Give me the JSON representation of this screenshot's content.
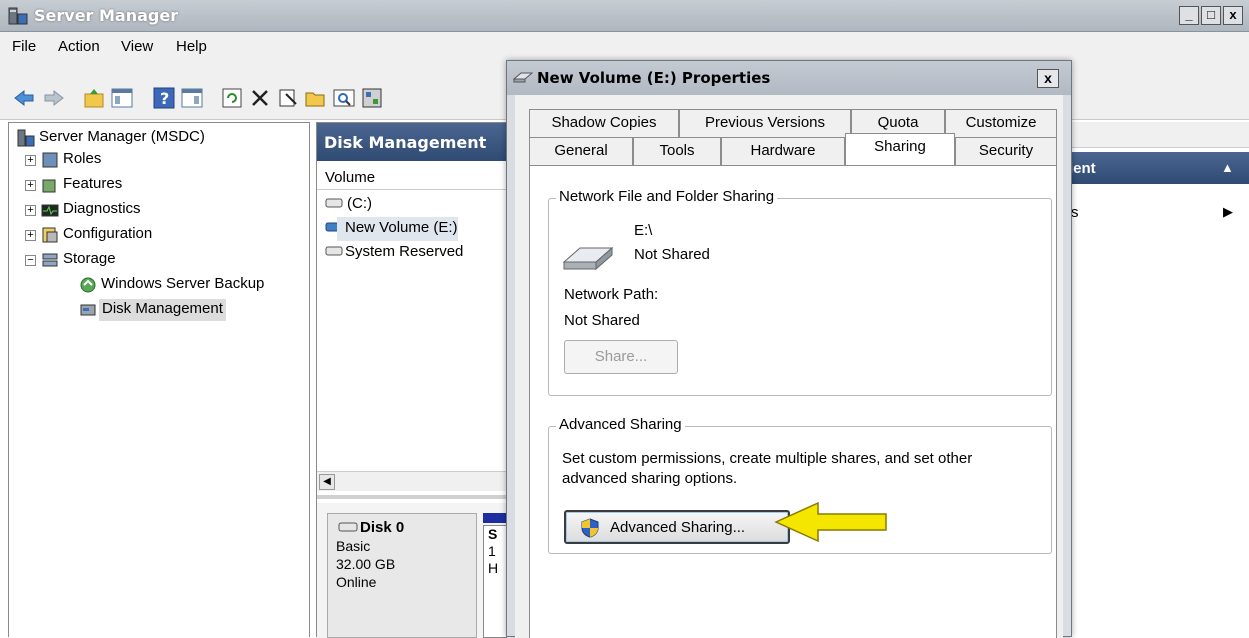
{
  "main_window": {
    "title": "Server Manager",
    "caption_buttons": {
      "minimize": "_",
      "maximize": "□",
      "close": "x"
    },
    "menu": [
      "File",
      "Action",
      "View",
      "Help"
    ]
  },
  "tree": {
    "root": "Server Manager (MSDC)",
    "items": [
      {
        "label": "Roles",
        "expander": "+"
      },
      {
        "label": "Features",
        "expander": "+"
      },
      {
        "label": "Diagnostics",
        "expander": "+"
      },
      {
        "label": "Configuration",
        "expander": "+"
      },
      {
        "label": "Storage",
        "expander": "−"
      }
    ],
    "storage_children": [
      "Windows Server Backup",
      "Disk Management"
    ]
  },
  "center": {
    "header": "Disk Management",
    "volume_column": "Volume",
    "volumes": [
      "(C:)",
      "New Volume (E:)",
      "System Reserved"
    ],
    "disk": {
      "name": "Disk 0",
      "type": "Basic",
      "size": "32.00 GB",
      "status": "Online"
    },
    "partition_col_letters": [
      "S",
      "1",
      "H"
    ]
  },
  "right_pane": {
    "header_fragment": "ient",
    "row_fragment": "s"
  },
  "dialog": {
    "title": "New Volume (E:) Properties",
    "close_label": "x",
    "tabs_row1": [
      "Shadow Copies",
      "Previous Versions",
      "Quota",
      "Customize"
    ],
    "tabs_row2": [
      "General",
      "Tools",
      "Hardware",
      "Sharing",
      "Security"
    ],
    "active_tab": "Sharing",
    "network_group": {
      "legend": "Network File and Folder Sharing",
      "drive": "E:\\",
      "drive_status": "Not Shared",
      "path_label": "Network Path:",
      "path_value": "Not Shared",
      "share_button": "Share..."
    },
    "advanced_group": {
      "legend": "Advanced Sharing",
      "description_line1": "Set custom permissions, create multiple shares, and set other",
      "description_line2": "advanced sharing options.",
      "button": "Advanced Sharing..."
    }
  },
  "colors": {
    "annotation_arrow": "#f5e600",
    "header_blue": "#2f4a73"
  }
}
